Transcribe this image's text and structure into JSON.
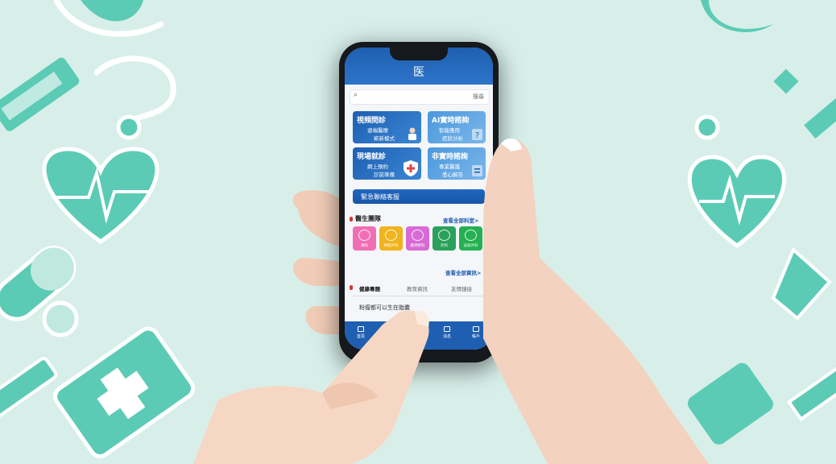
{
  "app": {
    "logo_text": "医",
    "search": {
      "placeholder": "",
      "button_label": "搜尋"
    },
    "cards": [
      {
        "title": "視頻問診",
        "line1": "遠端醫療",
        "line2": "嶄新模式"
      },
      {
        "title": "AI實時諮詢",
        "line1": "智能應用",
        "line2": "症狀分析"
      },
      {
        "title": "現場就診",
        "line1": "網上預約",
        "line2": "診前準備"
      },
      {
        "title": "非實時諮詢",
        "line1": "專業醫護",
        "line2": "悉心解答"
      }
    ],
    "urgent_button": "緊急聯絡客服",
    "team": {
      "title": "醫生團隊",
      "link": "查看全部科室>",
      "departments": [
        {
          "label": "骨科",
          "color": "#f06fb4"
        },
        {
          "label": "神經外科",
          "color": "#f0b41f"
        },
        {
          "label": "腦神經科",
          "color": "#d86ad6"
        },
        {
          "label": "外科",
          "color": "#2aa15b"
        },
        {
          "label": "泌尿外科",
          "color": "#25b052"
        }
      ]
    },
    "info_link": "查看全部資訊>",
    "tabs": [
      {
        "label": "健康專題",
        "active": true
      },
      {
        "label": "教育資訊",
        "active": false
      },
      {
        "label": "友情鏈接",
        "active": false
      }
    ],
    "article_title": "粉瘤都可以生在脂囊",
    "bottom_nav": [
      {
        "label": "首頁",
        "icon": "home-icon"
      },
      {
        "label": "資訊",
        "icon": "news-icon"
      },
      {
        "label": "消息",
        "icon": "bell-icon"
      },
      {
        "label": "帳戶",
        "icon": "user-icon"
      }
    ]
  },
  "colors": {
    "background": "#d8efe9",
    "decor": "#5ccbb5",
    "primary_blue": "#1f5fb2"
  }
}
